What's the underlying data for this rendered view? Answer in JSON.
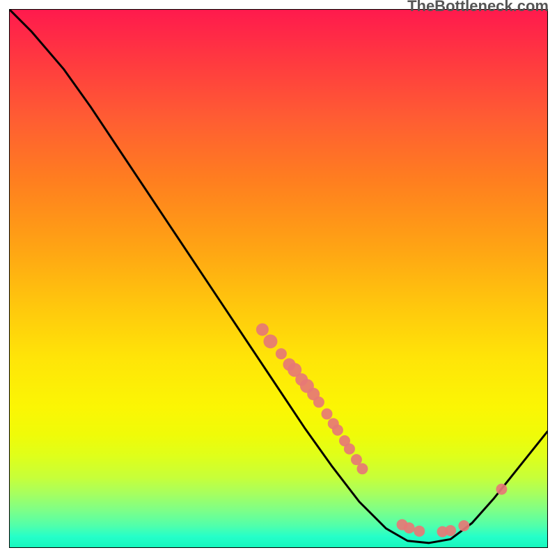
{
  "attribution": "TheBottleneck.com",
  "chart_data": {
    "type": "line",
    "title": "",
    "xlabel": "",
    "ylabel": "",
    "xlim": [
      0,
      100
    ],
    "ylim": [
      0,
      100
    ],
    "grid": false,
    "curve": [
      {
        "x": 0,
        "y": 100
      },
      {
        "x": 4,
        "y": 96
      },
      {
        "x": 10,
        "y": 89
      },
      {
        "x": 15,
        "y": 82
      },
      {
        "x": 20,
        "y": 74.5
      },
      {
        "x": 25,
        "y": 67
      },
      {
        "x": 30,
        "y": 59.5
      },
      {
        "x": 35,
        "y": 52
      },
      {
        "x": 40,
        "y": 44.5
      },
      {
        "x": 45,
        "y": 37
      },
      {
        "x": 50,
        "y": 29.5
      },
      {
        "x": 55,
        "y": 22
      },
      {
        "x": 60,
        "y": 15
      },
      {
        "x": 65,
        "y": 8.5
      },
      {
        "x": 70,
        "y": 3.5
      },
      {
        "x": 74,
        "y": 1.2
      },
      {
        "x": 78,
        "y": 0.8
      },
      {
        "x": 82,
        "y": 1.5
      },
      {
        "x": 86,
        "y": 4.5
      },
      {
        "x": 90,
        "y": 9
      },
      {
        "x": 94,
        "y": 14
      },
      {
        "x": 98,
        "y": 19
      },
      {
        "x": 100,
        "y": 21.5
      }
    ],
    "points": [
      {
        "x": 47,
        "y": 40.5,
        "size": 9
      },
      {
        "x": 48.5,
        "y": 38.3,
        "size": 10
      },
      {
        "x": 50.5,
        "y": 36,
        "size": 8
      },
      {
        "x": 52,
        "y": 34,
        "size": 9
      },
      {
        "x": 53,
        "y": 33,
        "size": 10
      },
      {
        "x": 54.3,
        "y": 31.2,
        "size": 9
      },
      {
        "x": 55.3,
        "y": 30,
        "size": 10
      },
      {
        "x": 56.5,
        "y": 28.5,
        "size": 9
      },
      {
        "x": 57.5,
        "y": 27,
        "size": 8
      },
      {
        "x": 59,
        "y": 24.8,
        "size": 8
      },
      {
        "x": 60.2,
        "y": 23,
        "size": 8
      },
      {
        "x": 61,
        "y": 21.8,
        "size": 8
      },
      {
        "x": 62.3,
        "y": 19.8,
        "size": 8
      },
      {
        "x": 63.2,
        "y": 18.3,
        "size": 8
      },
      {
        "x": 64.5,
        "y": 16.3,
        "size": 8
      },
      {
        "x": 65.6,
        "y": 14.6,
        "size": 8
      },
      {
        "x": 73,
        "y": 4.2,
        "size": 8
      },
      {
        "x": 74.3,
        "y": 3.6,
        "size": 8
      },
      {
        "x": 76.2,
        "y": 3.0,
        "size": 8
      },
      {
        "x": 80.5,
        "y": 2.9,
        "size": 8
      },
      {
        "x": 82,
        "y": 3.1,
        "size": 8
      },
      {
        "x": 84.5,
        "y": 4.0,
        "size": 8
      },
      {
        "x": 91.5,
        "y": 10.8,
        "size": 8
      }
    ],
    "point_color": "#e67876",
    "curve_color": "#000000"
  }
}
